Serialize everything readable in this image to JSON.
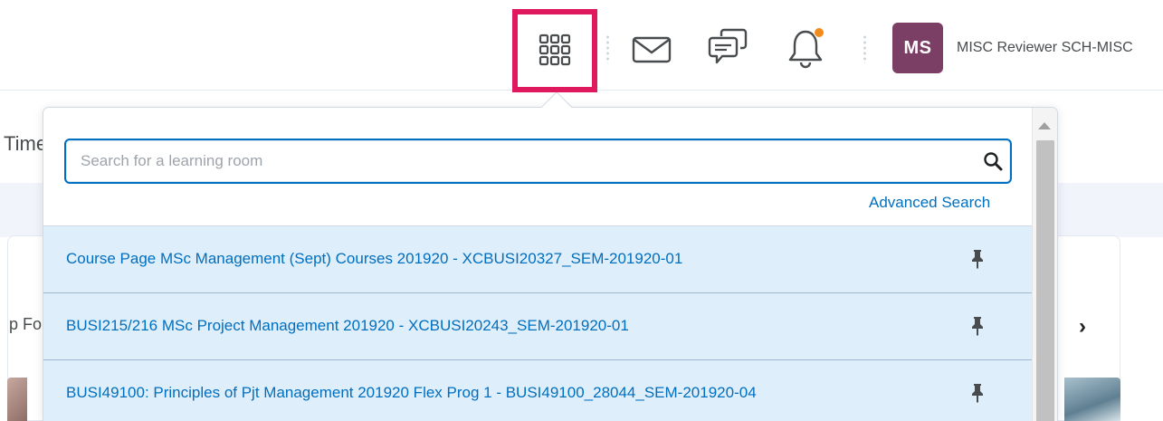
{
  "header": {
    "user_initials": "MS",
    "user_name": "MISC Reviewer SCH-MISC",
    "icons": {
      "waffle": "course-selector-grid-icon",
      "mail": "mail-envelope-icon",
      "chat": "chat-bubbles-icon",
      "bell": "notification-bell-icon"
    },
    "colors": {
      "avatar_bg": "#7b3e64",
      "notification_dot": "#f18c1b",
      "highlight": "#e0195f"
    }
  },
  "background": {
    "partial_text_1": "Time",
    "partial_text_2": "p Fo",
    "chevron": "›"
  },
  "dropdown": {
    "search": {
      "placeholder": "Search for a learning room",
      "value": ""
    },
    "advanced_search_label": "Advanced Search",
    "items": [
      {
        "label": "Course Page MSc Management (Sept) Courses 201920 - XCBUSI20327_SEM-201920-01"
      },
      {
        "label": "BUSI215/216 MSc Project Management 201920 - XCBUSI20243_SEM-201920-01"
      },
      {
        "label": "BUSI49100: Principles of Pjt Management 201920 Flex Prog 1 - BUSI49100_28044_SEM-201920-04"
      }
    ],
    "colors": {
      "link": "#006fbf",
      "item_bg": "#dfeefb"
    }
  }
}
